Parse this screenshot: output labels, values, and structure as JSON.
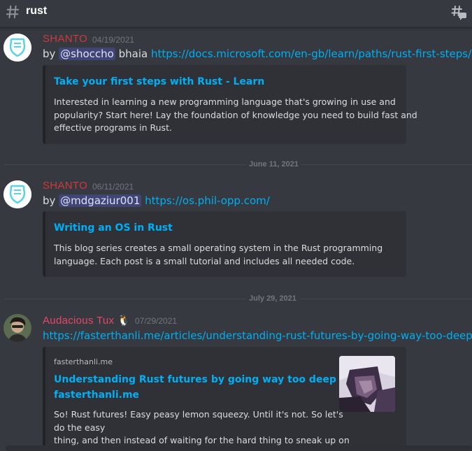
{
  "channel": {
    "name": "rust"
  },
  "colors": {
    "author_shanto": "#cd3b3b",
    "author_tux": "#e8476a",
    "link": "#00aff4"
  },
  "messages": [
    {
      "author": "SHANTO",
      "timestamp": "04/19/2021",
      "prefix": "by ",
      "mention": "@shoccho",
      "middle": " bhaia ",
      "link": "https://docs.microsoft.com/en-gb/learn/paths/rust-first-steps/",
      "embed": {
        "title": "Take your first steps with Rust - Learn",
        "description_lines": [
          "Interested in learning a new programming language that's growing in use and",
          "popularity? Start here! Lay the foundation of knowledge you need to build fast and",
          "effective programs in Rust."
        ]
      }
    },
    {
      "author": "SHANTO",
      "timestamp": "06/11/2021",
      "prefix": "by ",
      "mention": "@mdgaziur001",
      "link": "https://os.phil-opp.com/",
      "embed": {
        "title": "Writing an OS in Rust",
        "description_lines": [
          "This blog series creates a small operating system in the Rust programming",
          "language. Each post is a small tutorial and includes all needed code."
        ]
      }
    },
    {
      "author": "Audacious Tux",
      "author_emoji": "🐧",
      "timestamp": "07/29/2021",
      "link": "https://fasterthanli.me/articles/understanding-rust-futures-by-going-way-too-deep",
      "embed": {
        "provider": "fasterthanli.me",
        "title_lines": [
          "Understanding Rust futures by going way too deep -",
          "fasterthanli.me"
        ],
        "description_lines": [
          "So! Rust futures! Easy peasy lemon squeezy. Until it's not. So let's",
          "do the easy",
          "thing, and then instead of waiting for the hard thing to sneak up on"
        ]
      }
    }
  ],
  "dividers": [
    "June 11, 2021",
    "July 29, 2021"
  ]
}
